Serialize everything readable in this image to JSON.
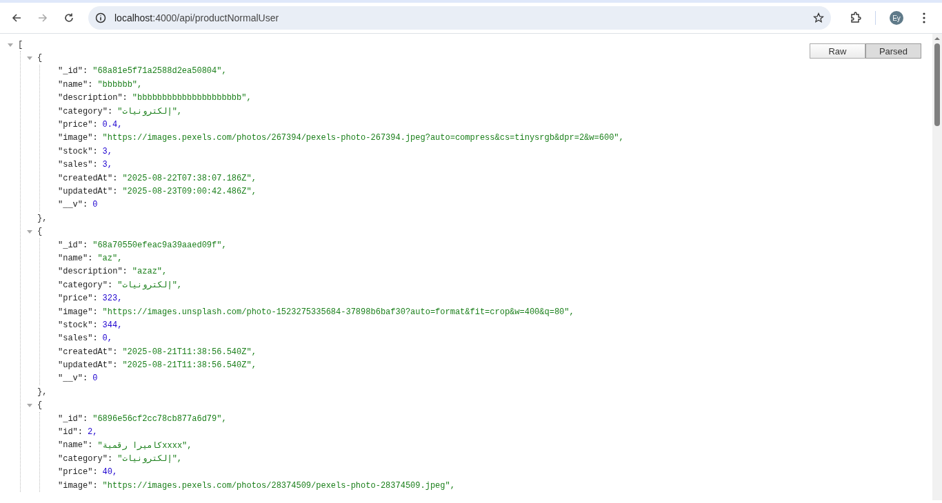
{
  "browser": {
    "url_host": "localhost",
    "url_rest": ":4000/api/productNormalUser",
    "profile": "Ey"
  },
  "view_buttons": [
    {
      "label": "Raw",
      "selected": false
    },
    {
      "label": "Parsed",
      "selected": true
    }
  ],
  "json_tree": {
    "open": "[",
    "expanded": true,
    "items": [
      {
        "open": "{",
        "close": "},",
        "expanded": true,
        "fields": [
          {
            "key": "\"_id\":",
            "value": "\"68a81e5f71a2588d2ea50804\",",
            "kind": "string"
          },
          {
            "key": "\"name\":",
            "value": "\"bbbbbb\",",
            "kind": "string"
          },
          {
            "key": "\"description\":",
            "value": "\"bbbbbbbbbbbbbbbbbbbbb\",",
            "kind": "string"
          },
          {
            "key": "\"category\":",
            "value": "\"إلكترونيات\",",
            "kind": "string"
          },
          {
            "key": "\"price\":",
            "value": "0.4,",
            "kind": "number"
          },
          {
            "key": "\"image\":",
            "value": "\"https://images.pexels.com/photos/267394/pexels-photo-267394.jpeg?auto=compress&cs=tinysrgb&dpr=2&w=600\",",
            "kind": "string"
          },
          {
            "key": "\"stock\":",
            "value": "3,",
            "kind": "number"
          },
          {
            "key": "\"sales\":",
            "value": "3,",
            "kind": "number"
          },
          {
            "key": "\"createdAt\":",
            "value": "\"2025-08-22T07:38:07.186Z\",",
            "kind": "string"
          },
          {
            "key": "\"updatedAt\":",
            "value": "\"2025-08-23T09:00:42.486Z\",",
            "kind": "string"
          },
          {
            "key": "\"__v\":",
            "value": "0",
            "kind": "number"
          }
        ]
      },
      {
        "open": "{",
        "close": "},",
        "expanded": true,
        "fields": [
          {
            "key": "\"_id\":",
            "value": "\"68a70550efeac9a39aaed09f\",",
            "kind": "string"
          },
          {
            "key": "\"name\":",
            "value": "\"az\",",
            "kind": "string"
          },
          {
            "key": "\"description\":",
            "value": "\"azaz\",",
            "kind": "string"
          },
          {
            "key": "\"category\":",
            "value": "\"إلكترونيات\",",
            "kind": "string"
          },
          {
            "key": "\"price\":",
            "value": "323,",
            "kind": "number"
          },
          {
            "key": "\"image\":",
            "value": "\"https://images.unsplash.com/photo-1523275335684-37898b6baf30?auto=format&fit=crop&w=400&q=80\",",
            "kind": "string"
          },
          {
            "key": "\"stock\":",
            "value": "344,",
            "kind": "number"
          },
          {
            "key": "\"sales\":",
            "value": "0,",
            "kind": "number"
          },
          {
            "key": "\"createdAt\":",
            "value": "\"2025-08-21T11:38:56.540Z\",",
            "kind": "string"
          },
          {
            "key": "\"updatedAt\":",
            "value": "\"2025-08-21T11:38:56.540Z\",",
            "kind": "string"
          },
          {
            "key": "\"__v\":",
            "value": "0",
            "kind": "number"
          }
        ]
      },
      {
        "open": "{",
        "expanded": true,
        "fields": [
          {
            "key": "\"_id\":",
            "value": "\"6896e56cf2cc78cb877a6d79\",",
            "kind": "string"
          },
          {
            "key": "\"id\":",
            "value": "2,",
            "kind": "number"
          },
          {
            "key": "\"name\":",
            "value": "\"كاميرا رقميةxxxx\",",
            "kind": "string"
          },
          {
            "key": "\"category\":",
            "value": "\"إلكترونيات\",",
            "kind": "string"
          },
          {
            "key": "\"price\":",
            "value": "40,",
            "kind": "number"
          },
          {
            "key": "\"image\":",
            "value": "\"https://images.pexels.com/photos/28374509/pexels-photo-28374509.jpeg\",",
            "kind": "string"
          }
        ]
      }
    ]
  }
}
